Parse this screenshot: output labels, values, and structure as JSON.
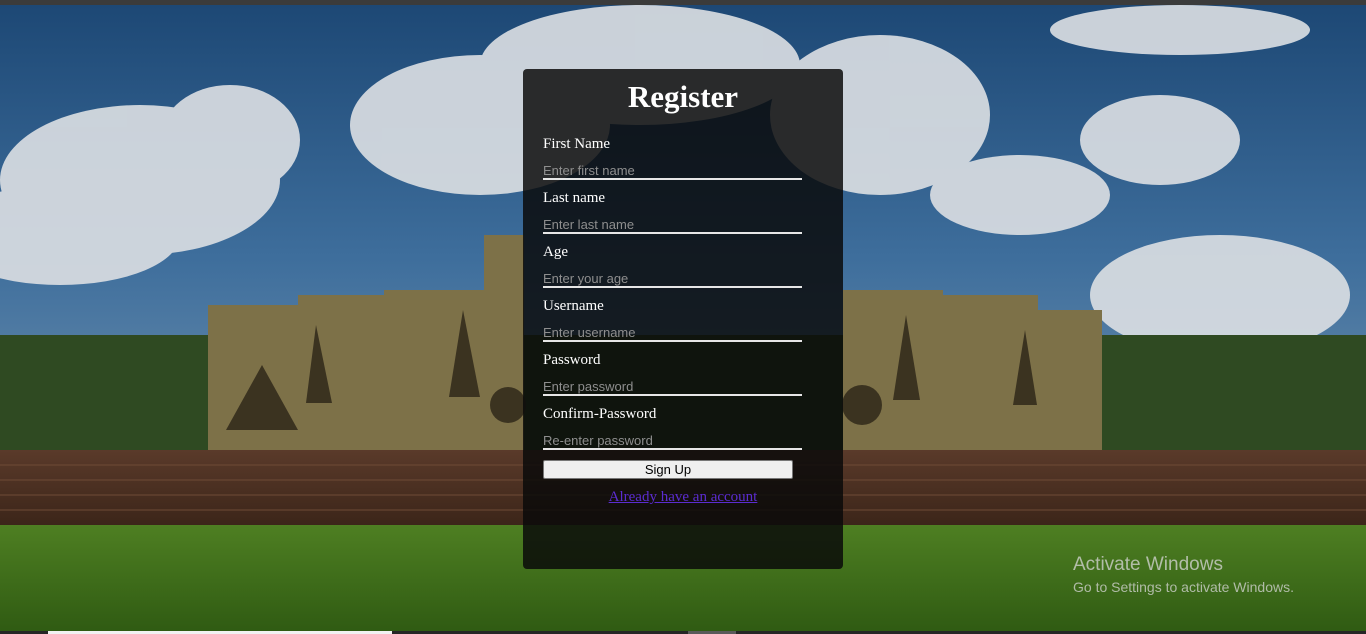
{
  "form": {
    "title": "Register",
    "fields": [
      {
        "label": "First Name",
        "placeholder": "Enter first name",
        "value": ""
      },
      {
        "label": "Last name",
        "placeholder": "Enter last name",
        "value": ""
      },
      {
        "label": "Age",
        "placeholder": "Enter your age",
        "value": ""
      },
      {
        "label": "Username",
        "placeholder": "Enter username",
        "value": ""
      },
      {
        "label": "Password",
        "placeholder": "Enter password",
        "value": ""
      },
      {
        "label": "Confirm-Password",
        "placeholder": "Re-enter password",
        "value": ""
      }
    ],
    "submit_label": "Sign Up",
    "login_link": "Already have an account"
  },
  "watermark": {
    "title": "Activate Windows",
    "subtitle": "Go to Settings to activate Windows."
  },
  "colors": {
    "card_bg": "#0a0a0a",
    "link": "#5b2cd1",
    "input_underline": "#e6e6e6"
  }
}
